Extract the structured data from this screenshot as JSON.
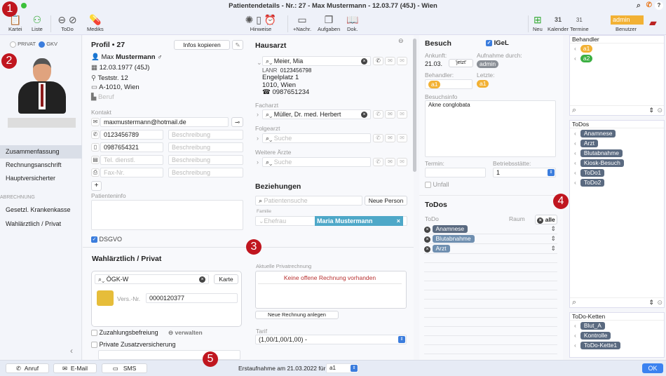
{
  "window": {
    "title": "Patientendetails - Nr.: 27 - Max Mustermann - 12.03.77 (45J) - Wien"
  },
  "toolbar": {
    "kartei": "Kartei",
    "liste": "Liste",
    "todo": "ToDo",
    "mediks": "Mediks",
    "hinweise": "Hinweise",
    "nachr": "+Nachr.",
    "aufgaben": "Aufgaben",
    "dok": "Dok.",
    "neu": "Neu",
    "kalender": "Kalender",
    "termine": "Termine",
    "calendar_day": "31",
    "user_value": "admin",
    "benutzer": "Benutzer",
    "user_color": "#f2b134"
  },
  "annotations": [
    "1",
    "2",
    "3",
    "4",
    "5"
  ],
  "sidebar": {
    "privat": "PRIVAT",
    "gkv": "GKV",
    "selected_insurance": "GKV",
    "items": [
      "Zusammenfassung",
      "Rechnungsanschrift",
      "Hauptversicherter"
    ],
    "section": "ABRECHNUNG",
    "billing_items": [
      "Gesetzl. Krankenkasse",
      "Wahlärztlich / Privat"
    ],
    "collapse": "‹"
  },
  "profile": {
    "title": "Profil",
    "bullet": "•",
    "number": "27",
    "copy_button": "Infos kopieren",
    "first_name": "Max",
    "last_name": "Mustermann",
    "gender": "♂",
    "birth": "12.03.1977 (45J)",
    "street": "Teststr. 12",
    "city": "A-1010, Wien",
    "job_placeholder": "Beruf",
    "kontakt_label": "Kontakt",
    "email": "maxmustermann@hotmail.de",
    "phone": "0123456789",
    "mobile": "0987654321",
    "work_placeholder": "Tel. dienstl.",
    "fax_placeholder": "Fax-Nr.",
    "desc_placeholder": "Beschreibung",
    "patinfo_label": "Patienteninfo",
    "dsgvo": "DSGVO",
    "add": "+"
  },
  "doctors": {
    "title": "Hausarzt",
    "hausarzt": "Meier, Mia",
    "lanr_label": "LANR",
    "lanr": "0123456798",
    "address1": "Engelplatz 1",
    "address2": "1010, Wien",
    "phone": "☎ 0987651234",
    "facharzt_label": "Facharzt",
    "facharzt": "Müller, Dr. med. Herbert",
    "folgearzt_label": "Folgearzt",
    "weitere_label": "Weitere Ärzte",
    "search_placeholder": "Suche"
  },
  "relations": {
    "title": "Beziehungen",
    "search_placeholder": "Patientensuche",
    "new_person": "Neue Person",
    "family_label": "Familie",
    "relation": "Ehefrau",
    "person": "Maria Mustermann",
    "person_color": "#4ea8c8"
  },
  "visit": {
    "title": "Besuch",
    "igel": "IGeL",
    "arrival_label": "Ankunft:",
    "arrival": "21.03.",
    "now_button": "'jetzt'",
    "admitted_label": "Aufnahme durch:",
    "admitted": "admin",
    "behandler_label": "Behandler:",
    "behandler": "a1",
    "last_label": "Letzte:",
    "last": "a1",
    "info_label": "Besuchsinfo",
    "info": "Akne conglobata",
    "termin_label": "Termin:",
    "site_label": "Betriebsstätte:",
    "site": "1",
    "unfall": "Unfall"
  },
  "todos": {
    "title": "ToDos",
    "col_todo": "ToDo",
    "col_room": "Raum",
    "room_value": "alle",
    "items": [
      "Anamnese",
      "Blutabnahme",
      "Arzt"
    ]
  },
  "private": {
    "title": "Wahlärztlich / Privat",
    "insurer": "ÖGK-W",
    "card_button": "Karte",
    "vers_label": "Vers.-Nr.",
    "vers": "0000120377",
    "zuzahlung": "Zuzahlungsbefreiung",
    "manage": "verwalten",
    "zusatz": "Private Zusatzversicherung",
    "invoice_label": "Aktuelle Privatrechnung",
    "no_invoice": "Keine offene Rechnung vorhanden",
    "new_invoice": "Neue Rechnung anlegen",
    "tarif_label": "Tarif",
    "tarif": "(1,00/1,00/1,00) -"
  },
  "right": {
    "behandler_title": "Behandler",
    "behandler": [
      {
        "label": "a1",
        "color": "#f2b134"
      },
      {
        "label": "a2",
        "color": "#3cb043"
      }
    ],
    "todos_title": "ToDos",
    "todos": [
      "Anamnese",
      "Arzt",
      "Blutabnahme",
      "Kiosk-Besuch",
      "ToDo1",
      "ToDo2"
    ],
    "chains_title": "ToDo-Ketten",
    "chains": [
      "Blut_A",
      "Kontrolle",
      "ToDo-Kette1"
    ]
  },
  "bottom": {
    "call": "Anruf",
    "email": "E-Mail",
    "sms": "SMS",
    "created": "Erstaufnahme am 21.03.2022 für",
    "created_for": "a1",
    "ok": "OK"
  }
}
